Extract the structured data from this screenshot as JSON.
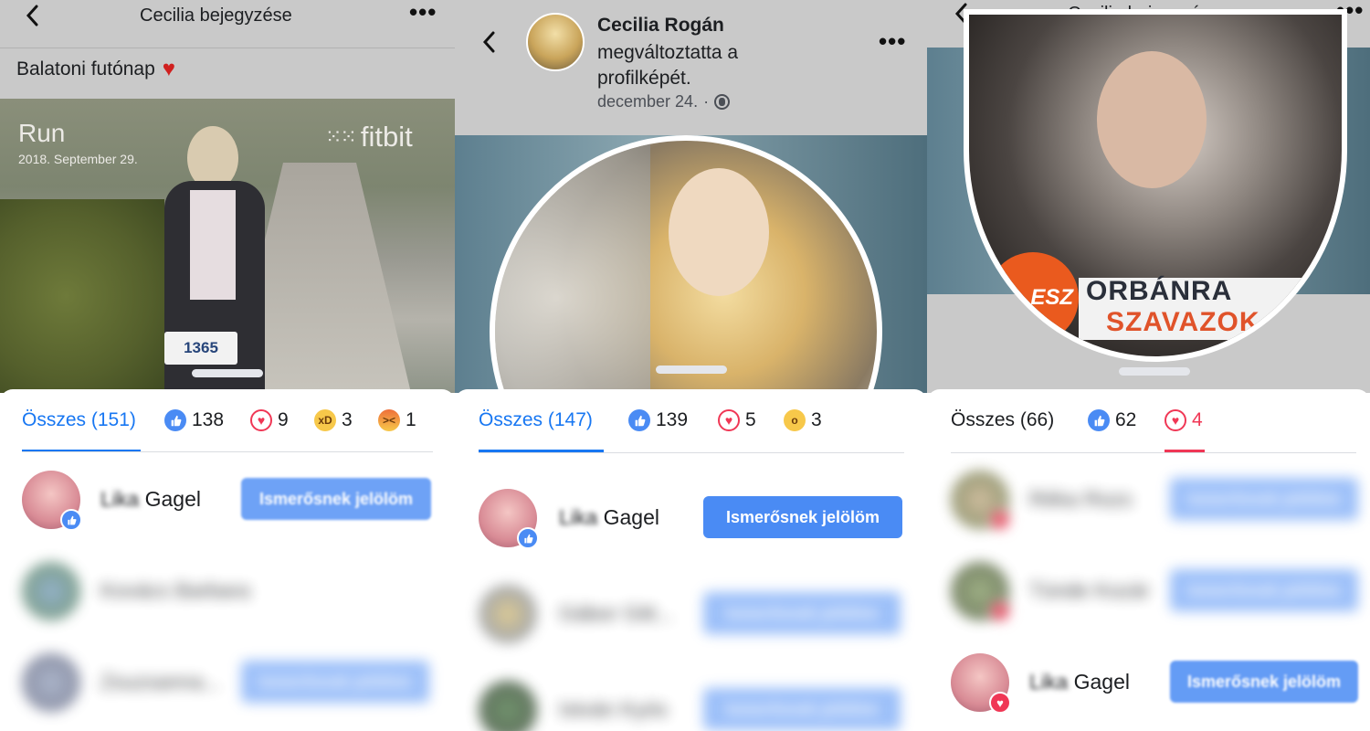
{
  "colors": {
    "accent": "#1877f2",
    "button": "#4a8bf4",
    "like": "#4a8bf4",
    "love": "#f03755",
    "overlay": "#c9c9c9"
  },
  "panel1": {
    "header_title": "Cecilia bejegyzése",
    "post_text": "Balatoni futónap",
    "photo_overlay": {
      "run_label": "Run",
      "date_label": "2018. September 29.",
      "brand_label": "fitbit",
      "bib_number": "1365"
    },
    "tabs": [
      {
        "label": "Összes (151)",
        "icon": ""
      },
      {
        "label": "138",
        "icon": "like-icon"
      },
      {
        "label": "9",
        "icon": "love-icon"
      },
      {
        "label": "3",
        "icon": "haha-icon"
      },
      {
        "label": "1",
        "icon": "angry-icon"
      }
    ],
    "rows": [
      {
        "name_blurred": "Lika",
        "name": "Gagel",
        "button": "Ismerősnek jelölöm"
      },
      {
        "name_blurred": "Kovács Barbara",
        "name": "",
        "button": ""
      },
      {
        "name_blurred": "Zsuzsanna...",
        "name": "",
        "button": "Ismerősnek jelölöm"
      }
    ]
  },
  "panel2": {
    "author": "Cecilia Rogán",
    "action": "megváltoztatta a profilképét.",
    "date": "december 24.",
    "tabs": [
      {
        "label": "Összes (147)",
        "icon": ""
      },
      {
        "label": "139",
        "icon": "like-icon"
      },
      {
        "label": "5",
        "icon": "love-icon"
      },
      {
        "label": "3",
        "icon": "wow-icon"
      }
    ],
    "rows": [
      {
        "name_blurred": "Lika",
        "name": "Gagel",
        "button": "Ismerősnek jelölöm"
      },
      {
        "name_blurred": "Gábor Gitt...",
        "name": "",
        "button": "Ismerősnek jelölöm"
      },
      {
        "name_blurred": "István Kyós",
        "name": "",
        "button": "Ismerősnek jelölöm"
      }
    ]
  },
  "panel3": {
    "header_title": "Cecilia bejegyzése",
    "badge_line1": "ORBÁNRA",
    "badge_line2": "SZAVAZOK",
    "badge_logo": "ESZ",
    "tabs": [
      {
        "label": "Összes (66)",
        "icon": ""
      },
      {
        "label": "62",
        "icon": "like-icon"
      },
      {
        "label": "4",
        "icon": "love-icon"
      }
    ],
    "rows": [
      {
        "name_blurred": "Réka Rozs",
        "name": "",
        "button": "Ismerősnek jelölöm"
      },
      {
        "name_blurred": "Tünde Kozár",
        "name": "",
        "button": "Ismerősnek jelölöm"
      },
      {
        "name_blurred": "Lika",
        "name": "Gagel",
        "button": "Ismerősnek jelölöm"
      }
    ]
  }
}
